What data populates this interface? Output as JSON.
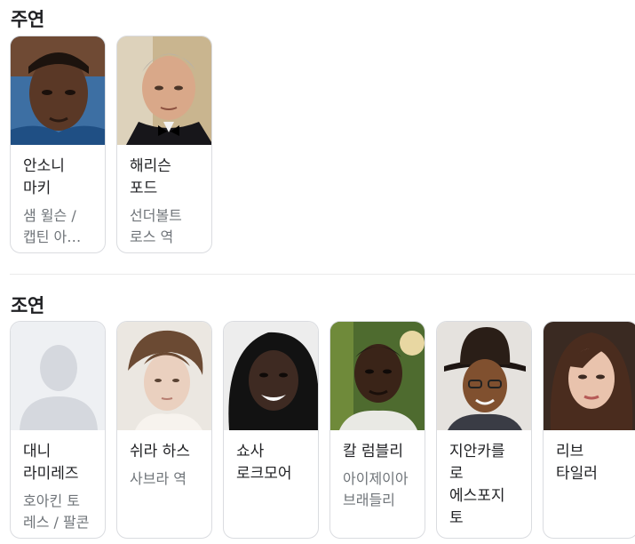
{
  "main_cast": {
    "heading": "주연",
    "cards": [
      {
        "name": "안소니 마키",
        "role": "샘 윌슨 / 캡틴 아메리카"
      },
      {
        "name": "해리슨 포드",
        "role": "선더볼트 로스 역"
      }
    ]
  },
  "supporting_cast": {
    "heading": "조연",
    "cards": [
      {
        "name": "대니 라미레즈",
        "role": "호아킨 토레스 / 팔콘"
      },
      {
        "name": "쉬라 하스",
        "role": "사브라 역"
      },
      {
        "name": "쇼사 로크모어",
        "role": ""
      },
      {
        "name": "칼 럼블리",
        "role": "아이제이아 브래들리"
      },
      {
        "name": "지안카를로 에스포지토",
        "role": ""
      },
      {
        "name": "리브 타일러",
        "role": ""
      }
    ]
  }
}
